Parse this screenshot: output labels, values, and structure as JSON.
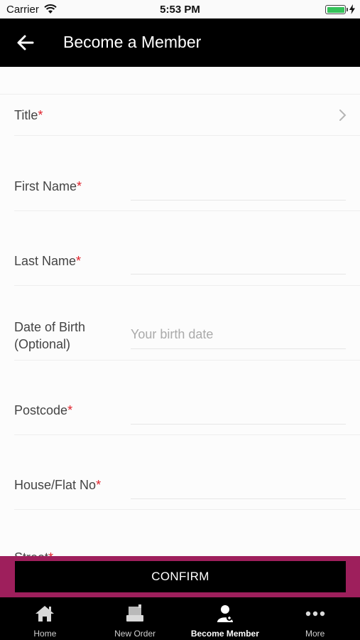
{
  "status_bar": {
    "carrier": "Carrier",
    "time": "5:53 PM"
  },
  "nav": {
    "title": "Become a Member"
  },
  "form": {
    "required_marker": "*",
    "fields": [
      {
        "label": "Title",
        "required": true,
        "type": "select",
        "placeholder": ""
      },
      {
        "label": "First Name",
        "required": true,
        "type": "text",
        "placeholder": ""
      },
      {
        "label": "Last Name",
        "required": true,
        "type": "text",
        "placeholder": ""
      },
      {
        "label_line1": "Date of Birth",
        "label_line2": "(Optional)",
        "required": false,
        "type": "text",
        "placeholder": "Your birth date"
      },
      {
        "label": "Postcode",
        "required": true,
        "type": "text",
        "placeholder": ""
      },
      {
        "label": "House/Flat No",
        "required": true,
        "type": "text",
        "placeholder": ""
      },
      {
        "label": "Street",
        "required": true,
        "type": "text",
        "placeholder": ""
      }
    ]
  },
  "confirm": {
    "label": "CONFIRM"
  },
  "tabs": [
    {
      "label": "Home",
      "icon": "home-icon",
      "active": false
    },
    {
      "label": "New Order",
      "icon": "new-order-icon",
      "active": false
    },
    {
      "label": "Become Member",
      "icon": "member-icon",
      "active": true
    },
    {
      "label": "More",
      "icon": "more-dots-icon",
      "active": false
    }
  ],
  "colors": {
    "nav_bg": "#000000",
    "confirm_bar_bg": "#9e1f5c",
    "required_marker": "#e0202a",
    "battery": "#35c35a"
  }
}
